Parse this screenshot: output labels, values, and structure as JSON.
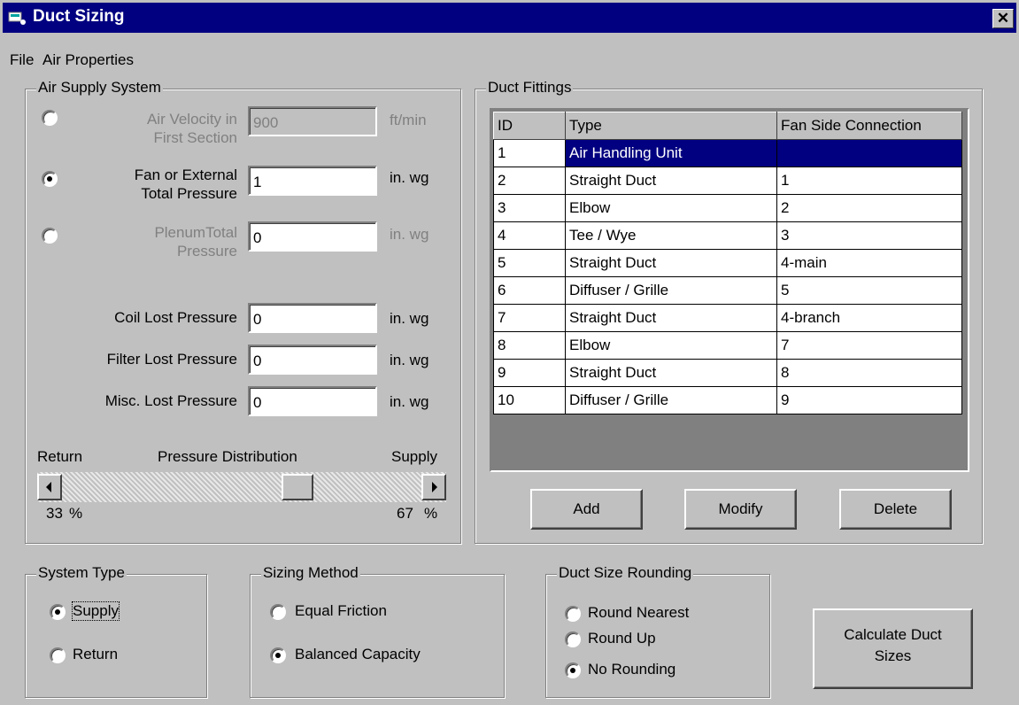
{
  "window": {
    "title": "Duct Sizing",
    "close_glyph": "✕"
  },
  "menu": [
    "File",
    "Air Properties"
  ],
  "air_supply": {
    "legend": "Air Supply System",
    "velocity": {
      "label1": "Air Velocity in",
      "label2": "First Section",
      "value": "900",
      "unit": "ft/min",
      "selected": false
    },
    "fan_pressure": {
      "label1": "Fan or External",
      "label2": "Total Pressure",
      "value": "1",
      "unit": "in. wg",
      "selected": true
    },
    "plenum_pressure": {
      "label1": "PlenumTotal",
      "label2": "Pressure",
      "value": "0",
      "unit": "in. wg",
      "selected": false
    },
    "coil": {
      "label": "Coil Lost Pressure",
      "value": "0",
      "unit": "in. wg"
    },
    "filter": {
      "label": "Filter Lost Pressure",
      "value": "0",
      "unit": "in. wg"
    },
    "misc": {
      "label": "Misc. Lost Pressure",
      "value": "0",
      "unit": "in. wg"
    },
    "distribution": {
      "left_label": "Return",
      "center_label": "Pressure Distribution",
      "right_label": "Supply",
      "return_pct": "33",
      "supply_pct": "67",
      "percent_sign": "%",
      "return_fraction": 0.67
    }
  },
  "duct_fittings": {
    "legend": "Duct Fittings",
    "columns": [
      "ID",
      "Type",
      "Fan Side Connection"
    ],
    "rows": [
      {
        "id": "1",
        "type": "Air Handling Unit",
        "fan": ""
      },
      {
        "id": "2",
        "type": "Straight Duct",
        "fan": "1"
      },
      {
        "id": "3",
        "type": "Elbow",
        "fan": "2"
      },
      {
        "id": "4",
        "type": "Tee / Wye",
        "fan": "3"
      },
      {
        "id": "5",
        "type": "Straight Duct",
        "fan": "4-main"
      },
      {
        "id": "6",
        "type": "Diffuser / Grille",
        "fan": "5"
      },
      {
        "id": "7",
        "type": "Straight Duct",
        "fan": "4-branch"
      },
      {
        "id": "8",
        "type": "Elbow",
        "fan": "7"
      },
      {
        "id": "9",
        "type": "Straight Duct",
        "fan": "8"
      },
      {
        "id": "10",
        "type": "Diffuser / Grille",
        "fan": "9"
      }
    ],
    "buttons": {
      "add": "Add",
      "modify": "Modify",
      "delete": "Delete"
    }
  },
  "system_type": {
    "legend": "System Type",
    "supply": "Supply",
    "return": "Return",
    "selected": "Supply"
  },
  "sizing_method": {
    "legend": "Sizing Method",
    "equal": "Equal Friction",
    "balanced": "Balanced Capacity",
    "selected": "Balanced Capacity"
  },
  "rounding": {
    "legend": "Duct Size Rounding",
    "nearest": "Round Nearest",
    "up": "Round Up",
    "none": "No Rounding",
    "selected": "No Rounding"
  },
  "calculate": {
    "line1": "Calculate Duct",
    "line2": "Sizes"
  }
}
